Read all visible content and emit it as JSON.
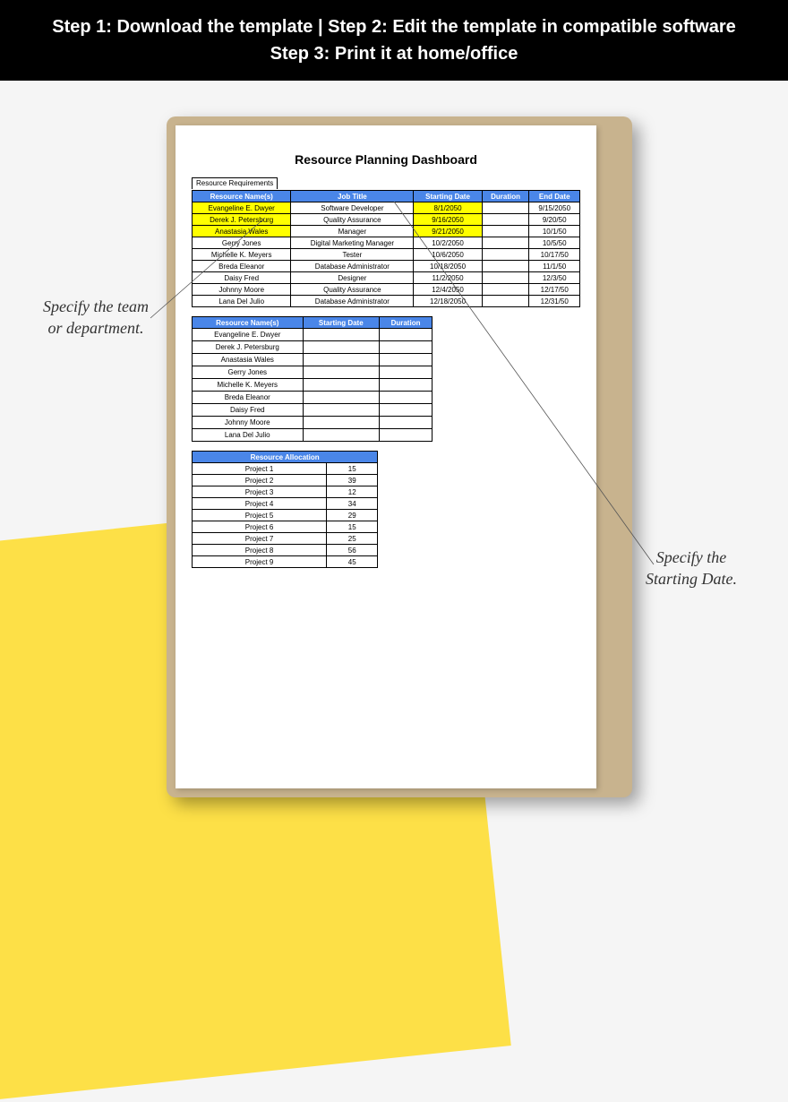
{
  "header": {
    "line1": "Step 1: Download the template | Step 2: Edit the template in compatible software",
    "line2": "Step 3: Print it at home/office"
  },
  "doc_title": "Resource Planning Dashboard",
  "section_label": "Resource Requirements",
  "table1": {
    "headers": [
      "Resource Name(s)",
      "Job Title",
      "Starting Date",
      "Duration",
      "End Date"
    ],
    "rows": [
      {
        "name": "Evangeline E. Dwyer",
        "title": "Software Developer",
        "start": "8/1/2050",
        "dur": "",
        "end": "9/15/2050",
        "hl": true
      },
      {
        "name": "Derek J. Petersburg",
        "title": "Quality Assurance",
        "start": "9/16/2050",
        "dur": "",
        "end": "9/20/50",
        "hl": true
      },
      {
        "name": "Anastasia Wales",
        "title": "Manager",
        "start": "9/21/2050",
        "dur": "",
        "end": "10/1/50",
        "hl": true
      },
      {
        "name": "Gerry Jones",
        "title": "Digital Marketing Manager",
        "start": "10/2/2050",
        "dur": "",
        "end": "10/5/50",
        "hl": false
      },
      {
        "name": "Michelle K. Meyers",
        "title": "Tester",
        "start": "10/6/2050",
        "dur": "",
        "end": "10/17/50",
        "hl": false
      },
      {
        "name": "Breda Eleanor",
        "title": "Database Administrator",
        "start": "10/18/2050",
        "dur": "",
        "end": "11/1/50",
        "hl": false
      },
      {
        "name": "Daisy Fred",
        "title": "Designer",
        "start": "11/2/2050",
        "dur": "",
        "end": "12/3/50",
        "hl": false
      },
      {
        "name": "Johnny Moore",
        "title": "Quality Assurance",
        "start": "12/4/2050",
        "dur": "",
        "end": "12/17/50",
        "hl": false
      },
      {
        "name": "Lana Del Julio",
        "title": "Database Administrator",
        "start": "12/18/2050",
        "dur": "",
        "end": "12/31/50",
        "hl": false
      }
    ]
  },
  "table2": {
    "headers": [
      "Resource Name(s)",
      "Starting Date",
      "Duration"
    ],
    "rows": [
      {
        "name": "Evangeline E. Dwyer",
        "start": "",
        "dur": ""
      },
      {
        "name": "Derek J. Petersburg",
        "start": "",
        "dur": ""
      },
      {
        "name": "Anastasia Wales",
        "start": "",
        "dur": ""
      },
      {
        "name": "Gerry Jones",
        "start": "",
        "dur": ""
      },
      {
        "name": "Michelle K. Meyers",
        "start": "",
        "dur": ""
      },
      {
        "name": "Breda Eleanor",
        "start": "",
        "dur": ""
      },
      {
        "name": "Daisy Fred",
        "start": "",
        "dur": ""
      },
      {
        "name": "Johnny Moore",
        "start": "",
        "dur": ""
      },
      {
        "name": "Lana Del Julio",
        "start": "",
        "dur": ""
      }
    ]
  },
  "table3": {
    "header": "Resource Allocation",
    "rows": [
      {
        "proj": "Project 1",
        "val": "15"
      },
      {
        "proj": "Project 2",
        "val": "39"
      },
      {
        "proj": "Project 3",
        "val": "12"
      },
      {
        "proj": "Project 4",
        "val": "34"
      },
      {
        "proj": "Project 5",
        "val": "29"
      },
      {
        "proj": "Project 6",
        "val": "15"
      },
      {
        "proj": "Project 7",
        "val": "25"
      },
      {
        "proj": "Project 8",
        "val": "56"
      },
      {
        "proj": "Project 9",
        "val": "45"
      }
    ]
  },
  "callouts": {
    "left": "Specify the team or department.",
    "right": "Specify the Starting Date."
  }
}
